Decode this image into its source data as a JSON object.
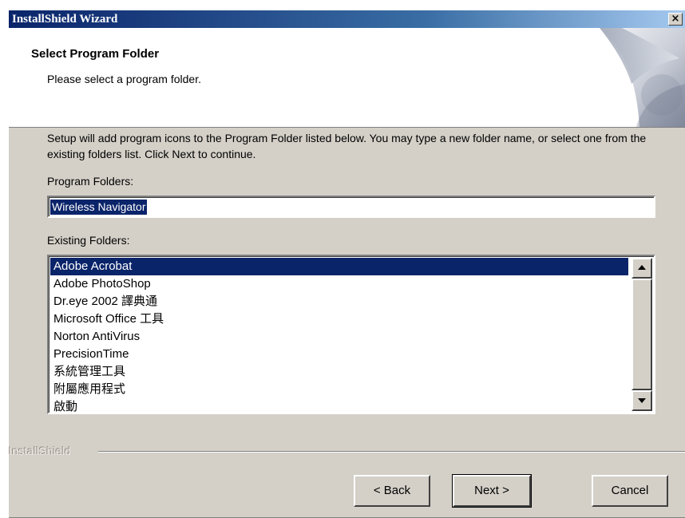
{
  "window": {
    "title": "InstallShield Wizard",
    "close_glyph": "×"
  },
  "header": {
    "title": "Select Program Folder",
    "subtitle": "Please select a program folder."
  },
  "main": {
    "description": "Setup will add program icons to the Program Folder listed below.  You may type a new folder name, or select one from the existing folders list.  Click Next to continue.",
    "program_folders_label": "Program Folders:",
    "program_folder_value": "Wireless Navigator",
    "existing_folders_label": "Existing Folders:",
    "existing_folders": [
      "Adobe Acrobat",
      "Adobe PhotoShop",
      "Dr.eye 2002 譯典通",
      "Microsoft Office 工具",
      "Norton AntiVirus",
      "PrecisionTime",
      "系統管理工具",
      "附屬應用程式",
      "啟動"
    ],
    "selected_folder": "Adobe Acrobat"
  },
  "footer": {
    "brand": "InstallShield",
    "back_label": "< Back",
    "next_label": "Next >",
    "cancel_label": "Cancel"
  },
  "icons": {
    "header_graphic": "page-curl-graphic",
    "close": "close-icon",
    "scroll_up": "up-arrow-icon",
    "scroll_down": "down-arrow-icon"
  },
  "colors": {
    "titlebar_start": "#0a246a",
    "titlebar_end": "#a6caf0",
    "selection": "#0a246a",
    "dialog_face": "#d4d0c8"
  }
}
